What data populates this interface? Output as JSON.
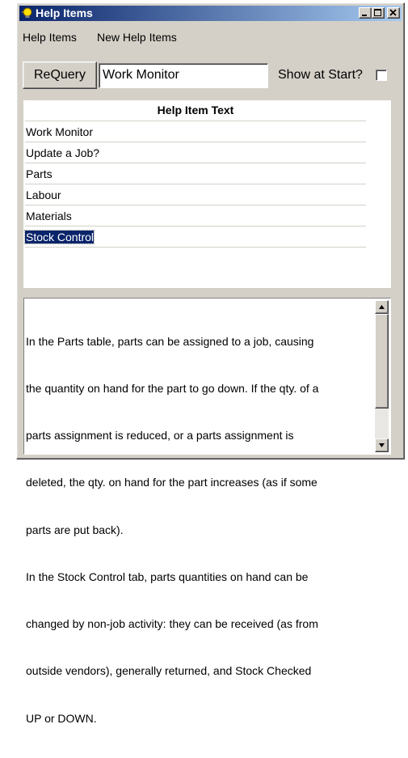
{
  "window": {
    "title": "Help Items",
    "icon": "lightbulb-icon",
    "controls": [
      "minimize-icon",
      "maximize-icon",
      "close-icon"
    ]
  },
  "menu": {
    "items": [
      "Help Items",
      "New Help Items"
    ]
  },
  "toolbar": {
    "requery_label": "ReQuery",
    "search_value": "Work Monitor",
    "show_at_start_label": "Show at Start?",
    "show_at_start_checked": false
  },
  "grid": {
    "column_header": "Help Item Text",
    "rows": [
      "Work Monitor",
      "Update a Job?",
      "Parts",
      "Labour",
      "Materials",
      "Stock Control"
    ],
    "selected_row": "Stock Control"
  },
  "memo": {
    "lines": [
      "In the Parts table, parts can be assigned to a job, causing",
      "the quantity on hand for the part to go down. If the qty. of a",
      "parts assignment is reduced, or a parts assignment is",
      "deleted, the qty. on hand for the part increases (as if some",
      "parts are put back).",
      "In the Stock Control tab, parts quantities on hand can be",
      "changed by non-job activity: they can be received (as from",
      "outside vendors), generally returned, and Stock Checked",
      "UP or DOWN."
    ]
  },
  "colors": {
    "title_bar_start": "#0a246a",
    "title_bar_end": "#a6caf0",
    "window_face": "#d4d0c8",
    "selection": "#0a246a"
  }
}
